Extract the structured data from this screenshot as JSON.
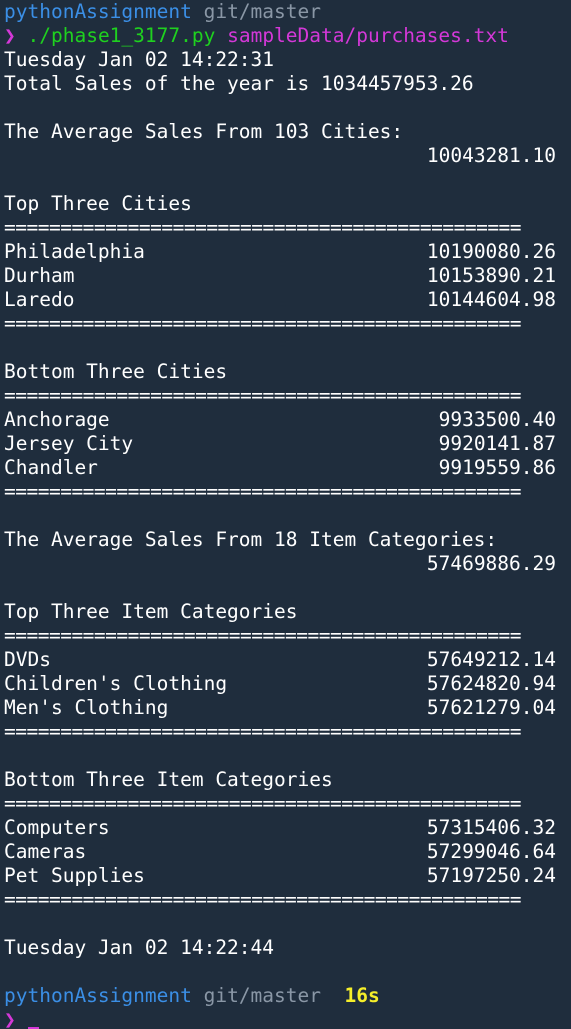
{
  "prompt1": {
    "dir": "pythonAssignment",
    "branch": "git/master",
    "arrow": "❯",
    "command": "./phase1_3177.py",
    "argument": "sampleData/purchases.txt"
  },
  "start_time": "Tuesday Jan 02 14:22:31",
  "total_sales": "Total Sales of the year is 1034457953.26",
  "city_avg_label": "The Average Sales From 103 Cities:",
  "city_avg_value": "10043281.10",
  "separator": "==============================================",
  "top_cities": {
    "title": "Top Three Cities",
    "rows": [
      {
        "name": "Philadelphia",
        "value": "10190080.26"
      },
      {
        "name": "Durham",
        "value": "10153890.21"
      },
      {
        "name": "Laredo",
        "value": "10144604.98"
      }
    ]
  },
  "bottom_cities": {
    "title": "Bottom Three Cities",
    "rows": [
      {
        "name": "Anchorage",
        "value": "9933500.40"
      },
      {
        "name": "Jersey City",
        "value": "9920141.87"
      },
      {
        "name": "Chandler",
        "value": "9919559.86"
      }
    ]
  },
  "category_avg_label": "The Average Sales From 18 Item Categories:",
  "category_avg_value": "57469886.29",
  "top_categories": {
    "title": "Top Three Item Categories",
    "rows": [
      {
        "name": "DVDs",
        "value": "57649212.14"
      },
      {
        "name": "Children's Clothing",
        "value": "57624820.94"
      },
      {
        "name": "Men's Clothing",
        "value": "57621279.04"
      }
    ]
  },
  "bottom_categories": {
    "title": "Bottom Three Item Categories",
    "rows": [
      {
        "name": "Computers",
        "value": "57315406.32"
      },
      {
        "name": "Cameras",
        "value": "57299046.64"
      },
      {
        "name": "Pet Supplies",
        "value": "57197250.24"
      }
    ]
  },
  "end_time": "Tuesday Jan 02 14:22:44",
  "prompt2": {
    "dir": "pythonAssignment",
    "branch": "git/master",
    "duration": "16s",
    "arrow": "❯"
  },
  "colors": {
    "background": "#1f2d3d",
    "dir": "#3b8fe6",
    "branch": "#8a97a6",
    "arrow": "#d438d8",
    "command": "#1fd11f",
    "argument": "#d438d8",
    "duration": "#f5ee2a"
  }
}
